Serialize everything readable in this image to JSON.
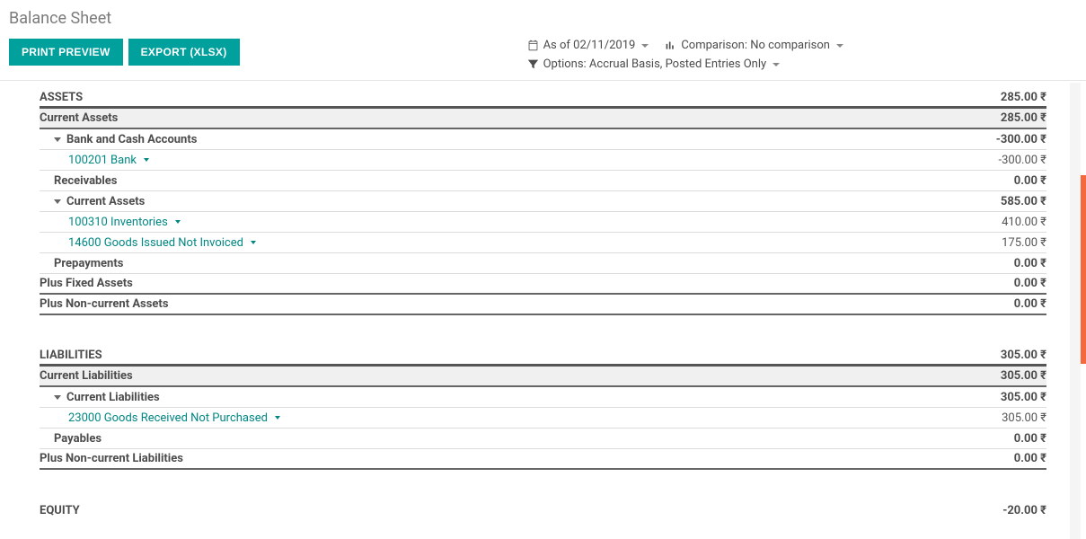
{
  "header": {
    "title": "Balance Sheet",
    "print_btn": "PRINT PREVIEW",
    "export_btn": "EXPORT (XLSX)"
  },
  "filters": {
    "asof_label": "As of 02/11/2019",
    "comparison_label": "Comparison: No comparison",
    "options_label": "Options: Accrual Basis, Posted Entries Only"
  },
  "sections": {
    "assets": {
      "title": "ASSETS",
      "value": "285.00 ₹",
      "current_assets_hdr": {
        "label": "Current Assets",
        "value": "285.00 ₹"
      },
      "bank_cash": {
        "label": "Bank and Cash Accounts",
        "value": "-300.00 ₹"
      },
      "bank_acct": {
        "label": "100201 Bank",
        "value": "-300.00 ₹"
      },
      "receivables": {
        "label": "Receivables",
        "value": "0.00 ₹"
      },
      "current_assets_sub": {
        "label": "Current Assets",
        "value": "585.00 ₹"
      },
      "inventories": {
        "label": "100310 Inventories",
        "value": "410.00 ₹"
      },
      "goods_issued": {
        "label": "14600 Goods Issued Not Invoiced",
        "value": "175.00 ₹"
      },
      "prepayments": {
        "label": "Prepayments",
        "value": "0.00 ₹"
      },
      "fixed_assets": {
        "label": "Plus Fixed Assets",
        "value": "0.00 ₹"
      },
      "noncurrent_assets": {
        "label": "Plus Non-current Assets",
        "value": "0.00 ₹"
      }
    },
    "liabilities": {
      "title": "LIABILITIES",
      "value": "305.00 ₹",
      "current_liab_hdr": {
        "label": "Current Liabilities",
        "value": "305.00 ₹"
      },
      "current_liab_sub": {
        "label": "Current Liabilities",
        "value": "305.00 ₹"
      },
      "goods_received": {
        "label": "23000 Goods Received Not Purchased",
        "value": "305.00 ₹"
      },
      "payables": {
        "label": "Payables",
        "value": "0.00 ₹"
      },
      "noncurrent_liab": {
        "label": "Plus Non-current Liabilities",
        "value": "0.00 ₹"
      }
    },
    "equity": {
      "title": "EQUITY",
      "value": "-20.00 ₹"
    }
  }
}
